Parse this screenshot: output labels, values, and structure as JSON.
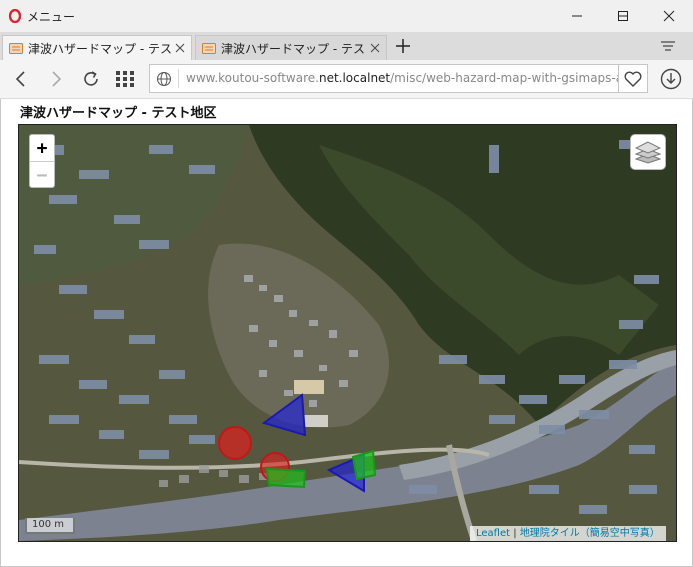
{
  "window": {
    "menu_label": "メニュー",
    "minimize_icon": "minimize-icon",
    "maximize_icon": "maximize-icon",
    "close_icon": "close-icon"
  },
  "tabs": [
    {
      "label": "津波ハザードマップ - テスト地区",
      "active": true
    },
    {
      "label": "津波ハザードマップ - テスト地区",
      "active": false
    }
  ],
  "toolbar": {
    "url_prefix": "www.koutou-software.",
    "url_host": "net.localnet",
    "url_path": "/misc/web-hazard-map-with-gsimaps-a"
  },
  "page": {
    "title": "津波ハザードマップ - テスト地区"
  },
  "map": {
    "zoom_in_label": "+",
    "zoom_out_label": "−",
    "scale_label": "100 m",
    "attribution_leaflet": "Leaflet",
    "attribution_sep": "|",
    "attribution_tiles": "地理院タイル（簡易空中写真）",
    "overlays": [
      {
        "kind": "circle",
        "color": "#e02020"
      },
      {
        "kind": "circle",
        "color": "#e02020"
      },
      {
        "kind": "triangle",
        "color": "#2020e0"
      },
      {
        "kind": "triangle",
        "color": "#2020e0"
      },
      {
        "kind": "rectangle",
        "color": "#20c020"
      },
      {
        "kind": "rectangle",
        "color": "#20c020"
      }
    ]
  }
}
